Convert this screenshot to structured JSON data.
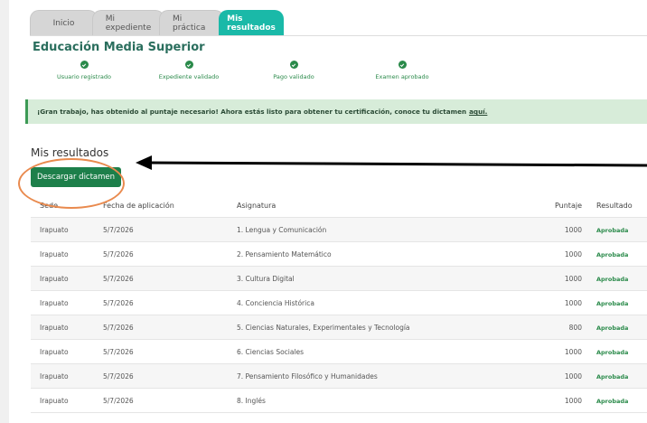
{
  "tabs": [
    {
      "label": "Inicio",
      "active": false
    },
    {
      "label": "Mi expediente",
      "active": false
    },
    {
      "label": "Mi práctica",
      "active": false
    },
    {
      "label": "Mis resultados",
      "active": true
    }
  ],
  "title": "Educación Media Superior",
  "steps": [
    {
      "label": "Usuario registrado",
      "icon": "check-icon"
    },
    {
      "label": "Expediente validado",
      "icon": "check-icon"
    },
    {
      "label": "Pago validado",
      "icon": "check-icon"
    },
    {
      "label": "Examen aprobado",
      "icon": "check-icon"
    }
  ],
  "alert": {
    "text": "¡Gran trabajo, has obtenido al puntaje necesario! Ahora estás listo para obtener tu certificación, conoce tu dictamen",
    "link": "aquí."
  },
  "results": {
    "title": "Mis resultados",
    "download_label": "Descargar dictamen",
    "headers": {
      "sede": "Sede",
      "fecha": "Fecha de aplicación",
      "asignatura": "Asignatura",
      "puntaje": "Puntaje",
      "resultado": "Resultado"
    },
    "rows": [
      {
        "sede": "Irapuato",
        "fecha": "5/7/2026",
        "asignatura": "1. Lengua y Comunicación",
        "puntaje": "1000",
        "resultado": "Aprobada"
      },
      {
        "sede": "Irapuato",
        "fecha": "5/7/2026",
        "asignatura": "2. Pensamiento Matemático",
        "puntaje": "1000",
        "resultado": "Aprobada"
      },
      {
        "sede": "Irapuato",
        "fecha": "5/7/2026",
        "asignatura": "3. Cultura Digital",
        "puntaje": "1000",
        "resultado": "Aprobada"
      },
      {
        "sede": "Irapuato",
        "fecha": "5/7/2026",
        "asignatura": "4. Conciencia Histórica",
        "puntaje": "1000",
        "resultado": "Aprobada"
      },
      {
        "sede": "Irapuato",
        "fecha": "5/7/2026",
        "asignatura": "5. Ciencias Naturales, Experimentales y Tecnología",
        "puntaje": "800",
        "resultado": "Aprobada"
      },
      {
        "sede": "Irapuato",
        "fecha": "5/7/2026",
        "asignatura": "6. Ciencias Sociales",
        "puntaje": "1000",
        "resultado": "Aprobada"
      },
      {
        "sede": "Irapuato",
        "fecha": "5/7/2026",
        "asignatura": "7. Pensamiento Filosófico y Humanidades",
        "puntaje": "1000",
        "resultado": "Aprobada"
      },
      {
        "sede": "Irapuato",
        "fecha": "5/7/2026",
        "asignatura": "8. Inglés",
        "puntaje": "1000",
        "resultado": "Aprobada"
      }
    ]
  },
  "colors": {
    "accent": "#1ab9a8",
    "success": "#2a8a4a",
    "button": "#1d7f4a",
    "annotation": "#e98a4e"
  }
}
